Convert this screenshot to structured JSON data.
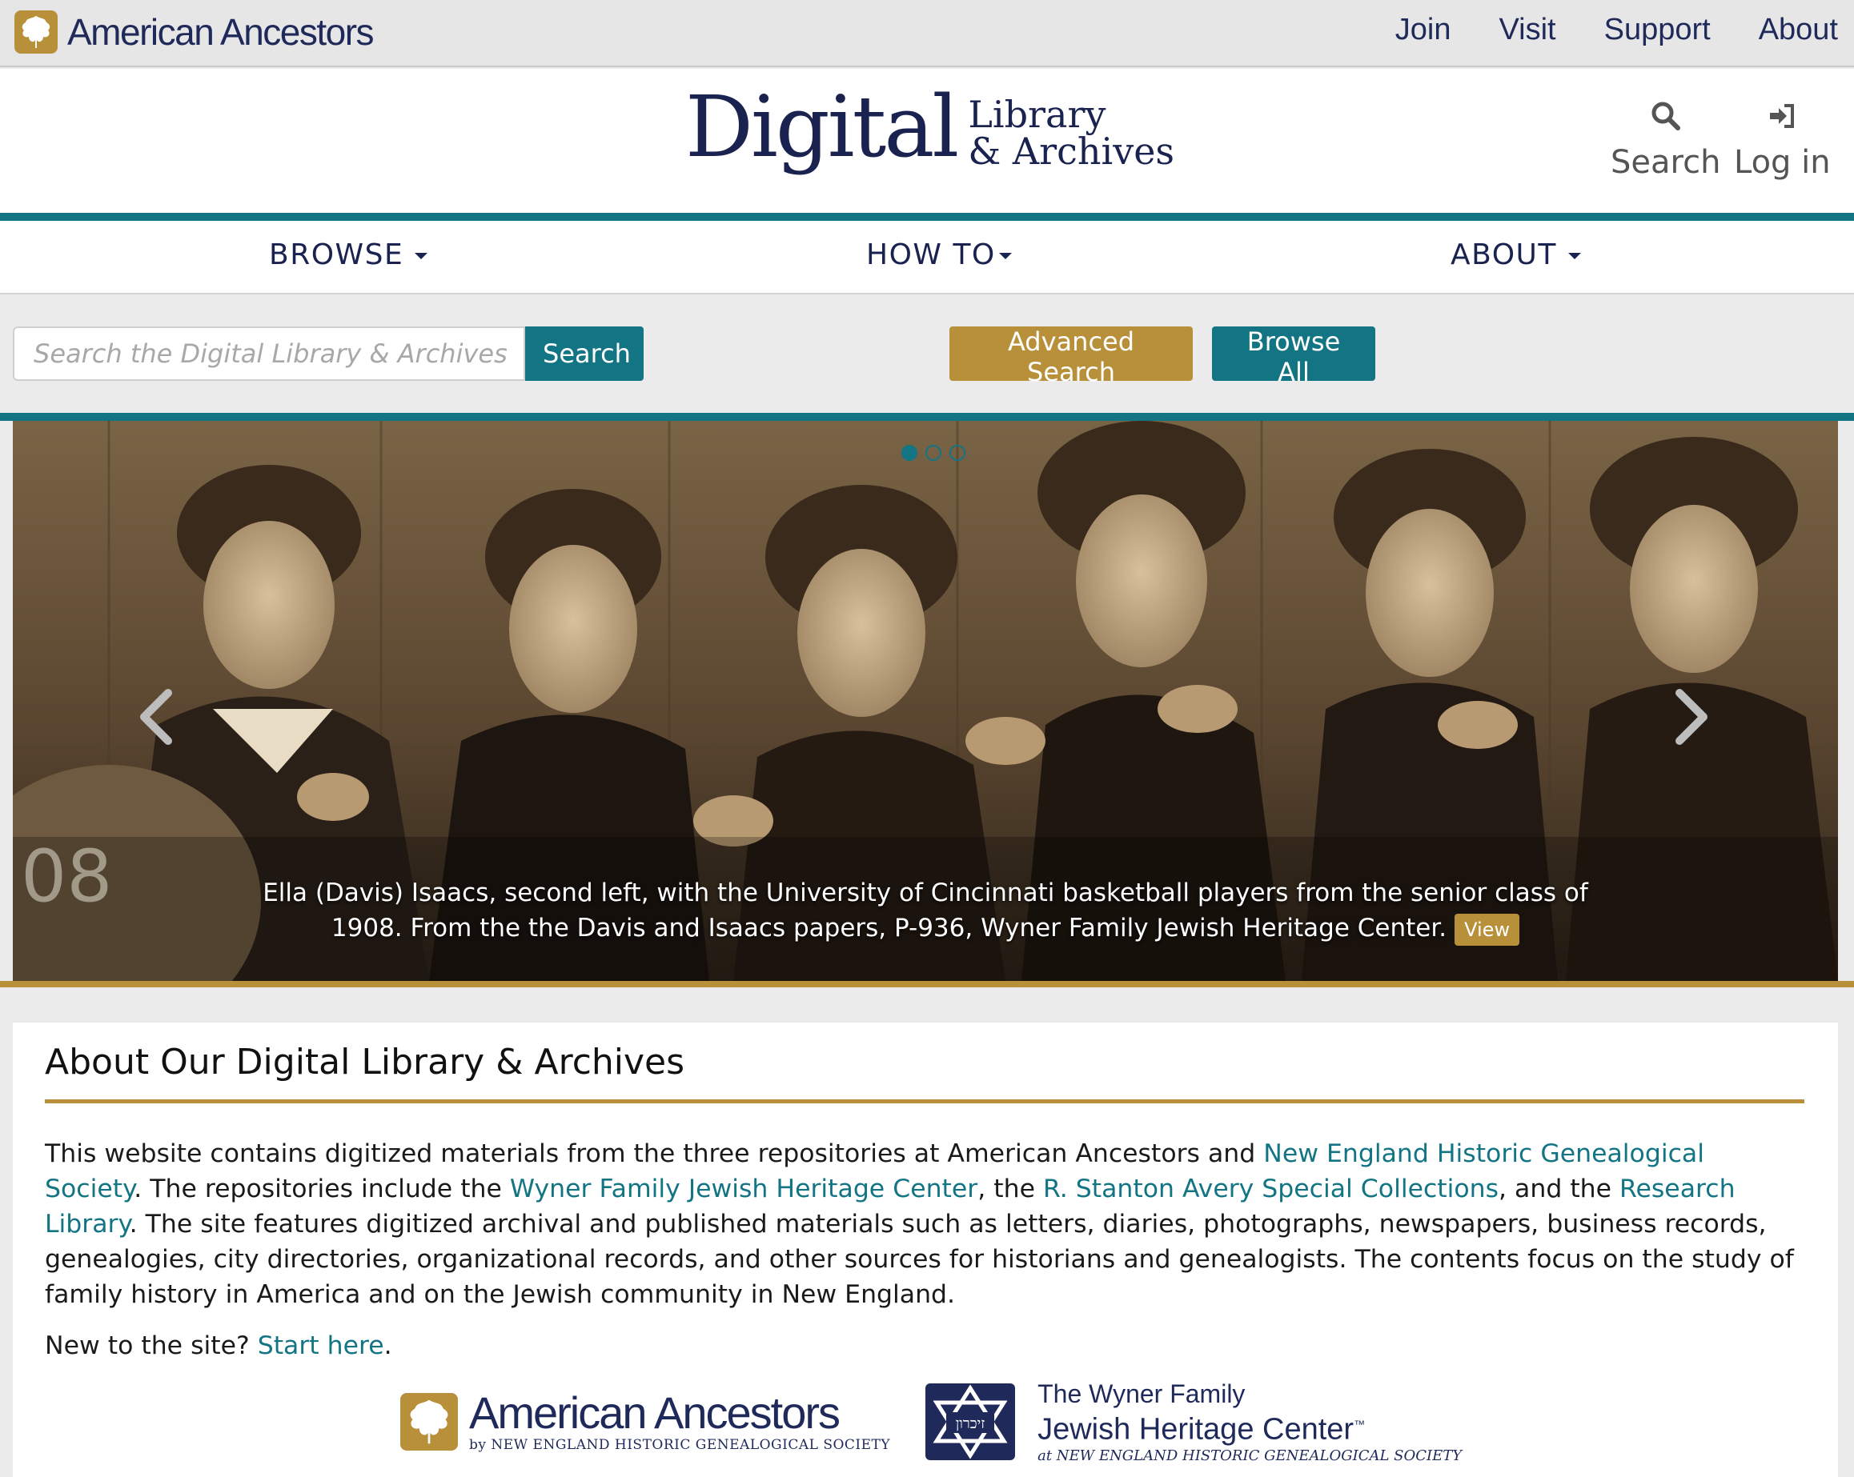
{
  "topbar": {
    "brand": "American Ancestors",
    "links": [
      "Join",
      "Visit",
      "Support",
      "About"
    ]
  },
  "header": {
    "logo_big": "Digital",
    "logo_small_1": "Library",
    "logo_small_2": "& Archives",
    "search_label": "Search",
    "login_label": "Log in"
  },
  "nav": {
    "browse": "BROWSE",
    "howto": "HOW TO",
    "about": "ABOUT"
  },
  "search": {
    "placeholder": "Search the Digital Library & Archives",
    "search_button": "Search",
    "advanced_button": "Advanced Search",
    "browse_all_button": "Browse All"
  },
  "carousel": {
    "slide_count": 3,
    "active_slide": 1,
    "caption": "Ella (Davis) Isaacs, second left, with the University of Cincinnati basketball players from the senior class of 1908. From the the Davis and Isaacs papers, P-936, Wyner Family Jewish Heritage Center.",
    "view_label": "View",
    "ball_text": "08"
  },
  "about": {
    "heading": "About Our Digital Library & Archives",
    "p1_a": "This website contains digitized materials from the three repositories at American Ancestors and ",
    "link_nehgs": "New England Historic Genealogical Society",
    "p1_b": ". The repositories include the ",
    "link_wyner": "Wyner Family Jewish Heritage Center",
    "p1_c": ", the ",
    "link_avery": "R. Stanton Avery Special Collections",
    "p1_d": ", and the ",
    "link_research": "Research Library",
    "p1_e": ". The site features digitized archival and published materials such as letters, diaries, photographs, newspapers, business records, genealogies, city directories, organizational records, and other sources for historians and genealogists. The contents focus on the study of family history in America and on the Jewish community in New England.",
    "p2_a": "New to the site? ",
    "link_start": "Start here",
    "p2_b": "."
  },
  "footer_logos": {
    "aa_main": "American Ancestors",
    "aa_sub": "by NEW ENGLAND HISTORIC GENEALOGICAL SOCIETY",
    "wyner_l1": "The Wyner Family",
    "wyner_l2": "Jewish Heritage Center",
    "wyner_l2_tm": "™",
    "wyner_l3": "at NEW ENGLAND HISTORIC GENEALOGICAL SOCIETY",
    "wyner_badge": "זיכרון"
  },
  "colors": {
    "teal": "#137584",
    "gold": "#b8903a",
    "navy": "#1a2250"
  }
}
